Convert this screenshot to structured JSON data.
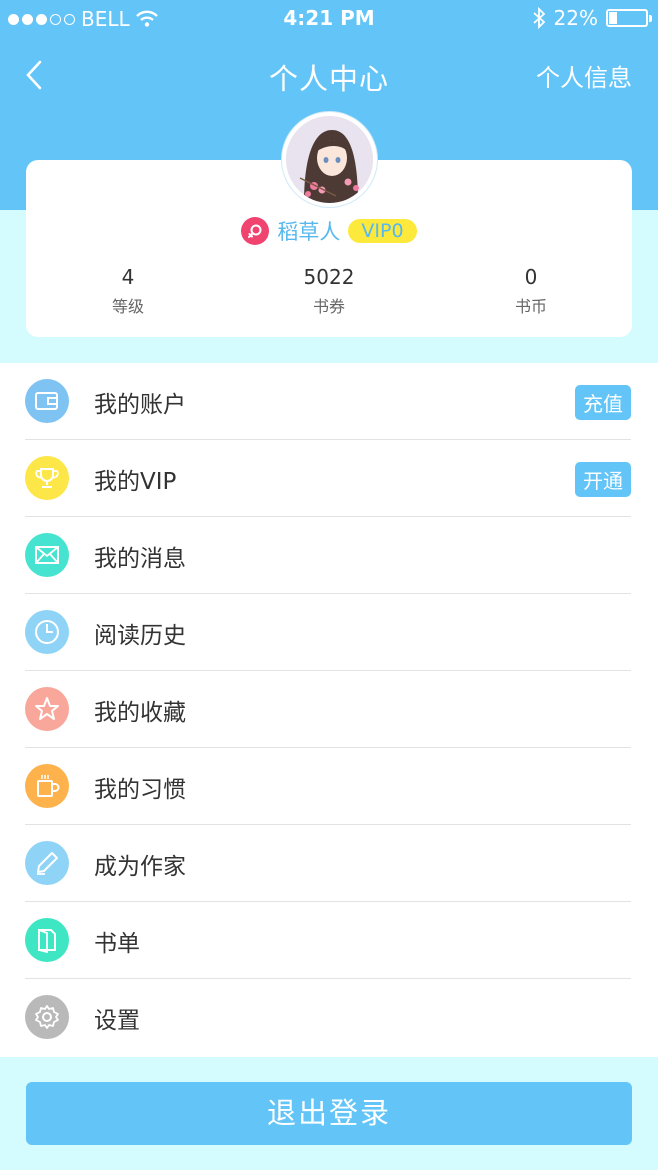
{
  "status_bar": {
    "carrier": "BELL",
    "time": "4:21 PM",
    "battery": "22%",
    "battery_level": 0.22
  },
  "nav": {
    "title": "个人中心",
    "right_label": "个人信息"
  },
  "profile": {
    "name": "稻草人",
    "vip": "VIP0"
  },
  "stats": [
    {
      "value": "4",
      "label": "等级"
    },
    {
      "value": "5022",
      "label": "书券"
    },
    {
      "value": "0",
      "label": "书币"
    }
  ],
  "menu": [
    {
      "label": "我的账户",
      "icon": "wallet-icon",
      "color": "#7fc3f3",
      "action": "充值"
    },
    {
      "label": "我的VIP",
      "icon": "trophy-icon",
      "color": "#fde648",
      "action": "开通"
    },
    {
      "label": "我的消息",
      "icon": "mail-icon",
      "color": "#46e4d0"
    },
    {
      "label": "阅读历史",
      "icon": "clock-icon",
      "color": "#8fd4f7"
    },
    {
      "label": "我的收藏",
      "icon": "star-icon",
      "color": "#f8a79a"
    },
    {
      "label": "我的习惯",
      "icon": "cup-icon",
      "color": "#fdb24b"
    },
    {
      "label": "成为作家",
      "icon": "pen-icon",
      "color": "#8fd4f7"
    },
    {
      "label": "书单",
      "icon": "book-icon",
      "color": "#3ee6c4"
    },
    {
      "label": "设置",
      "icon": "gear-icon",
      "color": "#b9b9b9"
    }
  ],
  "logout_label": "退出登录"
}
